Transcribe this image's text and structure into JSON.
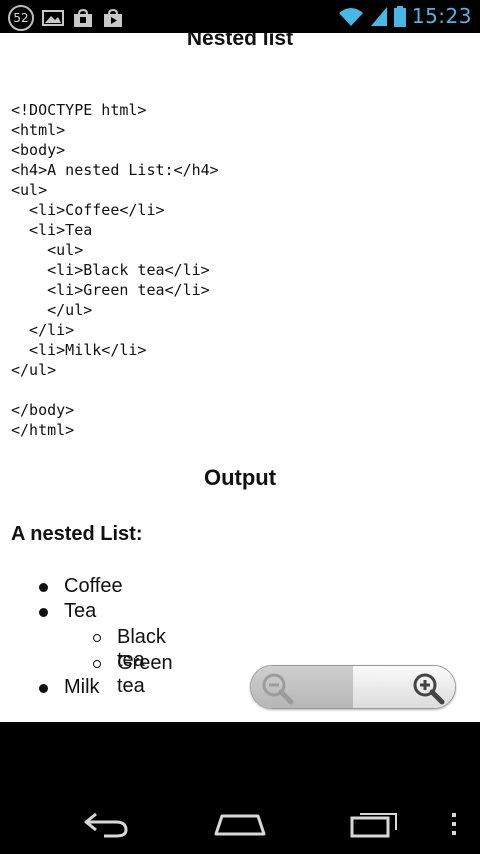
{
  "status_bar": {
    "notification_count": "52",
    "time": "15:23",
    "icons": [
      "notification-count-badge",
      "image-icon",
      "shopping-bag-icon",
      "play-store-icon",
      "wifi-icon",
      "signal-icon",
      "battery-icon"
    ]
  },
  "page": {
    "title": "Nested list",
    "code_lines": [
      "<!DOCTYPE html>",
      "<html>",
      "<body>",
      "<h4>A nested List:</h4>",
      "<ul>",
      "  <li>Coffee</li>",
      "  <li>Tea",
      "    <ul>",
      "    <li>Black tea</li>",
      "    <li>Green tea</li>",
      "    </ul>",
      "  </li>",
      "  <li>Milk</li>",
      "</ul>",
      "",
      "</body>",
      "</html>"
    ],
    "output_heading": "Output",
    "demo": {
      "heading": "A nested List:",
      "items": [
        "Coffee",
        "Tea",
        "Milk"
      ],
      "sub_items": [
        "Black tea",
        "Green tea"
      ]
    }
  },
  "zoom": {
    "out_icon": "zoom-out-icon",
    "in_icon": "zoom-in-icon"
  },
  "nav_bar": {
    "icons": [
      "back-icon",
      "home-icon",
      "recent-apps-icon",
      "menu-icon"
    ]
  },
  "colors": {
    "time_accent": "#47b7e6",
    "content_bg": "#ffffff",
    "system_bars": "#000000"
  }
}
